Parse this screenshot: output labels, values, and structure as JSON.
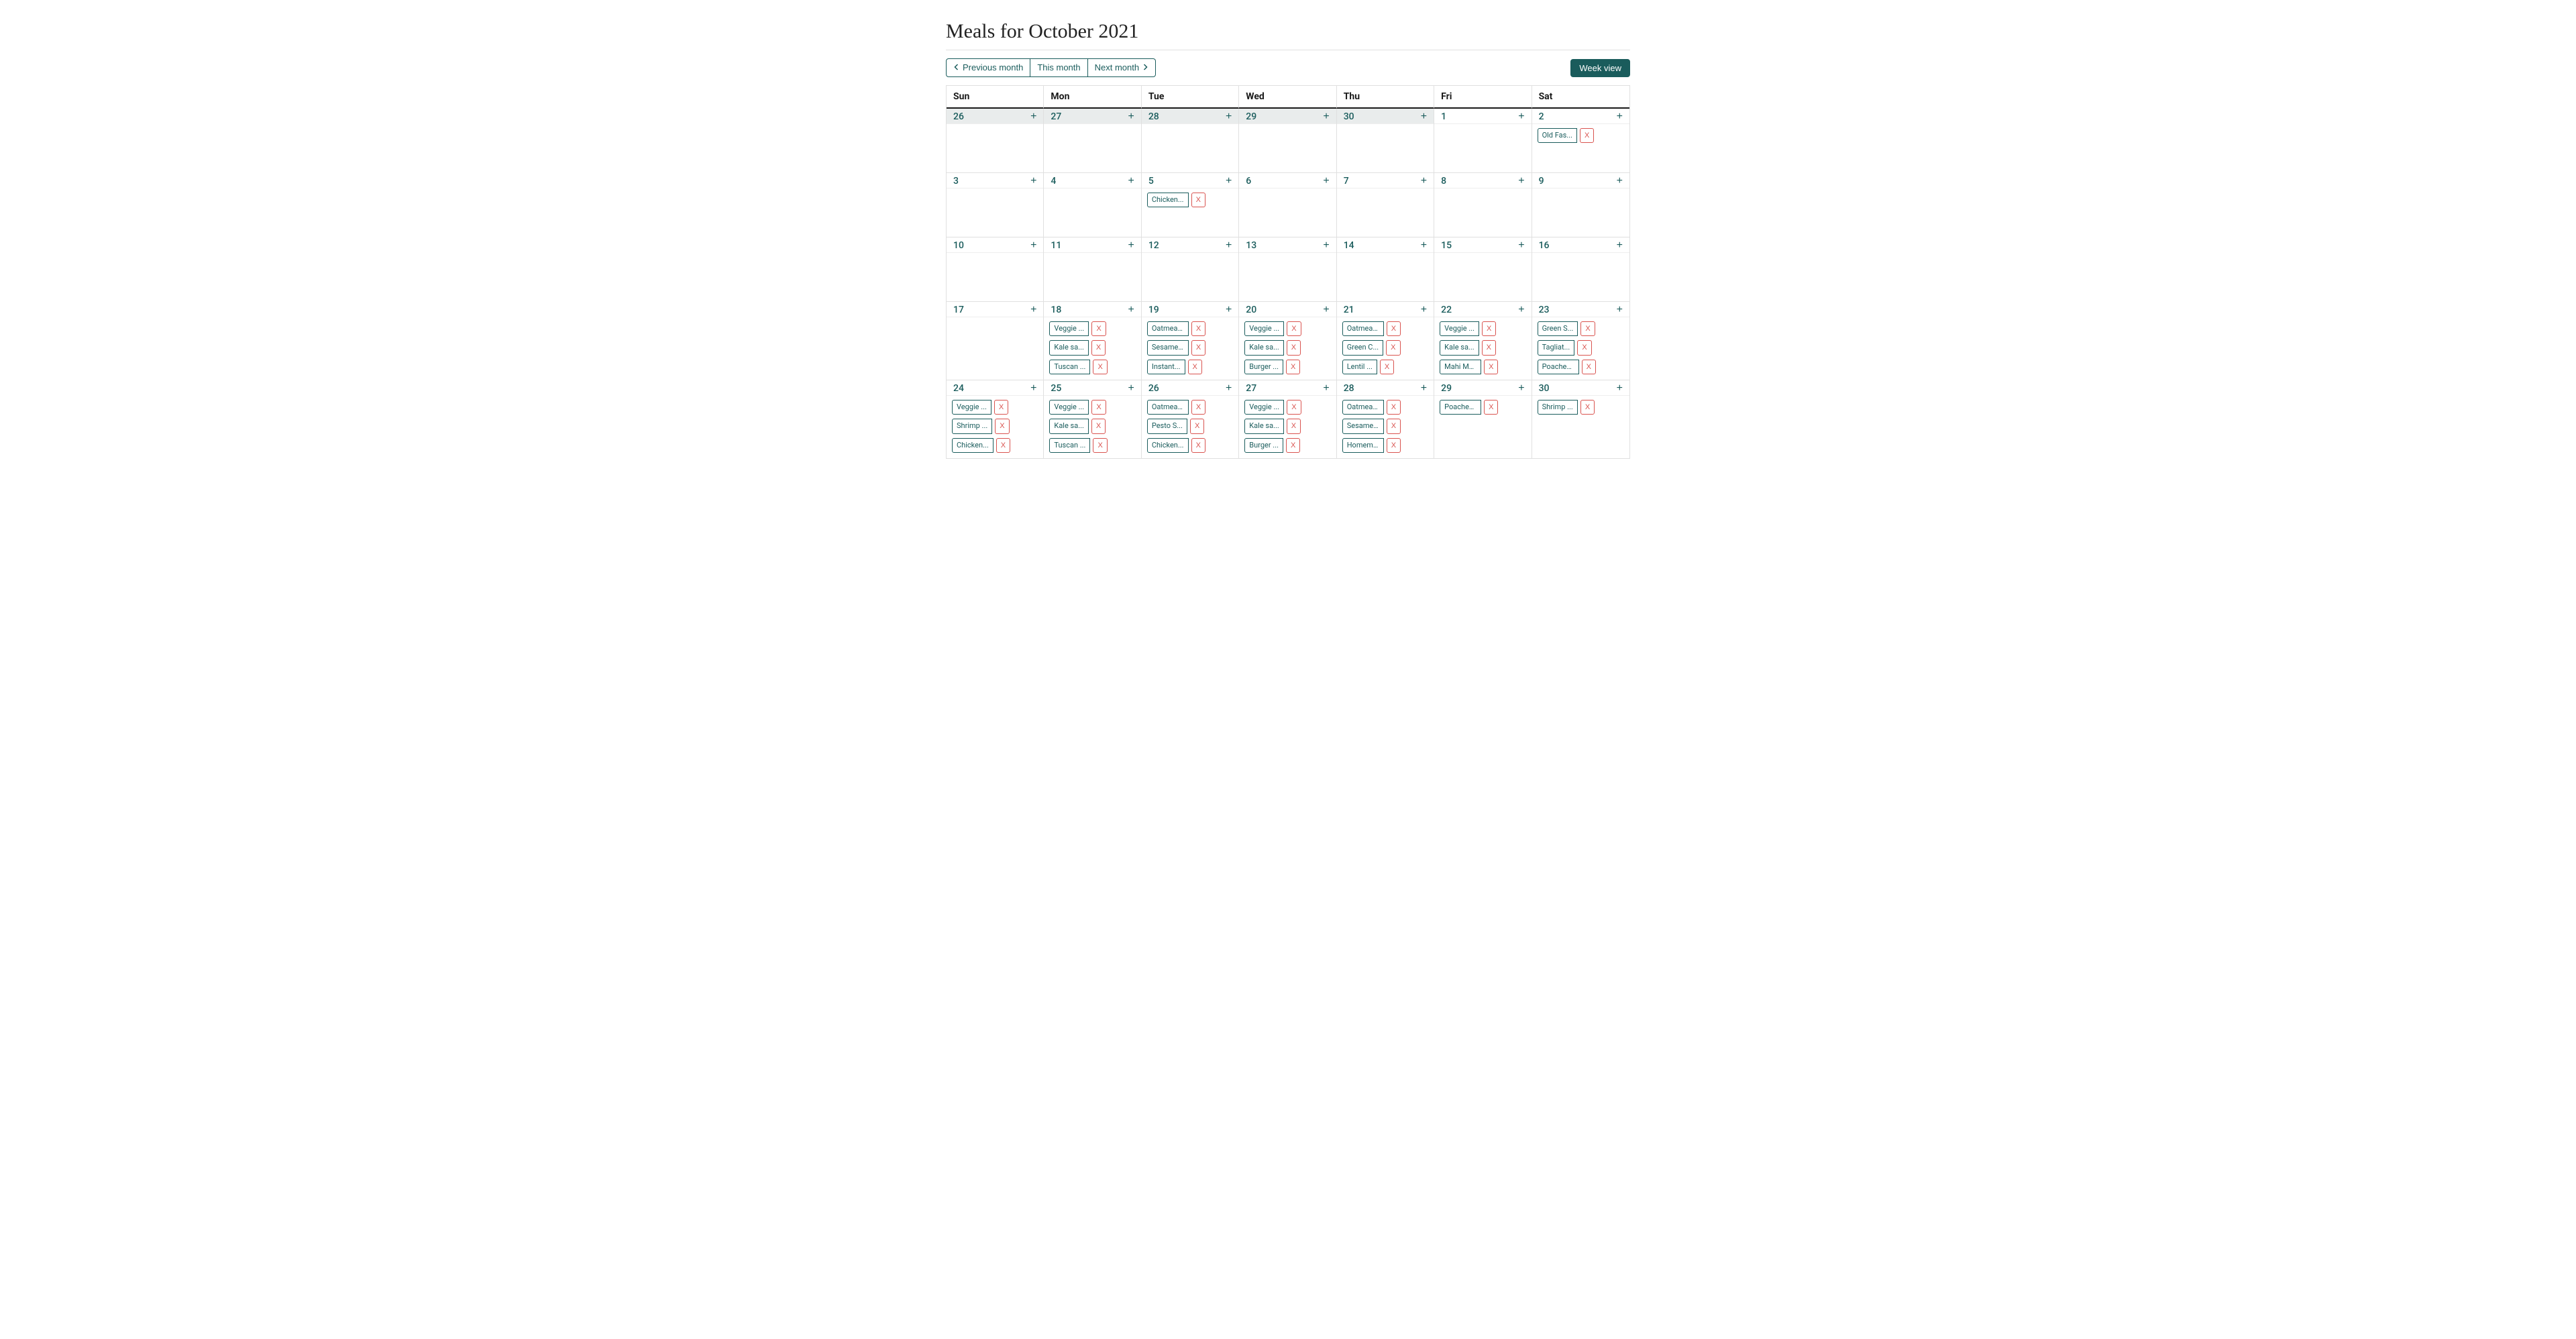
{
  "title": "Meals for October 2021",
  "toolbar": {
    "prev_label": "Previous month",
    "this_label": "This month",
    "next_label": "Next month",
    "week_view_label": "Week view"
  },
  "weekdays": [
    "Sun",
    "Mon",
    "Tue",
    "Wed",
    "Thu",
    "Fri",
    "Sat"
  ],
  "delete_glyph": "X",
  "add_glyph": "+",
  "days": [
    {
      "num": "26",
      "other_month": true,
      "meals": []
    },
    {
      "num": "27",
      "other_month": true,
      "meals": []
    },
    {
      "num": "28",
      "other_month": true,
      "meals": []
    },
    {
      "num": "29",
      "other_month": true,
      "meals": []
    },
    {
      "num": "30",
      "other_month": true,
      "meals": []
    },
    {
      "num": "1",
      "other_month": false,
      "meals": []
    },
    {
      "num": "2",
      "other_month": false,
      "meals": [
        "Old Fas..."
      ]
    },
    {
      "num": "3",
      "other_month": false,
      "meals": []
    },
    {
      "num": "4",
      "other_month": false,
      "meals": []
    },
    {
      "num": "5",
      "other_month": false,
      "meals": [
        "Chicken..."
      ]
    },
    {
      "num": "6",
      "other_month": false,
      "meals": []
    },
    {
      "num": "7",
      "other_month": false,
      "meals": []
    },
    {
      "num": "8",
      "other_month": false,
      "meals": []
    },
    {
      "num": "9",
      "other_month": false,
      "meals": []
    },
    {
      "num": "10",
      "other_month": false,
      "meals": []
    },
    {
      "num": "11",
      "other_month": false,
      "meals": []
    },
    {
      "num": "12",
      "other_month": false,
      "meals": []
    },
    {
      "num": "13",
      "other_month": false,
      "meals": []
    },
    {
      "num": "14",
      "other_month": false,
      "meals": []
    },
    {
      "num": "15",
      "other_month": false,
      "meals": []
    },
    {
      "num": "16",
      "other_month": false,
      "meals": []
    },
    {
      "num": "17",
      "other_month": false,
      "meals": []
    },
    {
      "num": "18",
      "other_month": false,
      "meals": [
        "Veggie ...",
        "Kale sa...",
        "Tuscan ..."
      ]
    },
    {
      "num": "19",
      "other_month": false,
      "meals": [
        "Oatmeal...",
        "Sesame ...",
        "Instant..."
      ]
    },
    {
      "num": "20",
      "other_month": false,
      "meals": [
        "Veggie ...",
        "Kale sa...",
        "Burger ..."
      ]
    },
    {
      "num": "21",
      "other_month": false,
      "meals": [
        "Oatmeal...",
        "Green C...",
        "Lentil ..."
      ]
    },
    {
      "num": "22",
      "other_month": false,
      "meals": [
        "Veggie ...",
        "Kale sa...",
        "Mahi Ma..."
      ]
    },
    {
      "num": "23",
      "other_month": false,
      "meals": [
        "Green S...",
        "Tagliat...",
        "Poached..."
      ]
    },
    {
      "num": "24",
      "other_month": false,
      "meals": [
        "Veggie ...",
        "Shrimp ...",
        "Chicken..."
      ]
    },
    {
      "num": "25",
      "other_month": false,
      "meals": [
        "Veggie ...",
        "Kale sa...",
        "Tuscan ..."
      ]
    },
    {
      "num": "26",
      "other_month": false,
      "meals": [
        "Oatmeal...",
        "Pesto S...",
        "Chicken..."
      ]
    },
    {
      "num": "27",
      "other_month": false,
      "meals": [
        "Veggie ...",
        "Kale sa...",
        "Burger ..."
      ]
    },
    {
      "num": "28",
      "other_month": false,
      "meals": [
        "Oatmeal...",
        "Sesame ...",
        "Homemad..."
      ]
    },
    {
      "num": "29",
      "other_month": false,
      "meals": [
        "Poached..."
      ]
    },
    {
      "num": "30",
      "other_month": false,
      "meals": [
        "Shrimp ..."
      ]
    }
  ]
}
